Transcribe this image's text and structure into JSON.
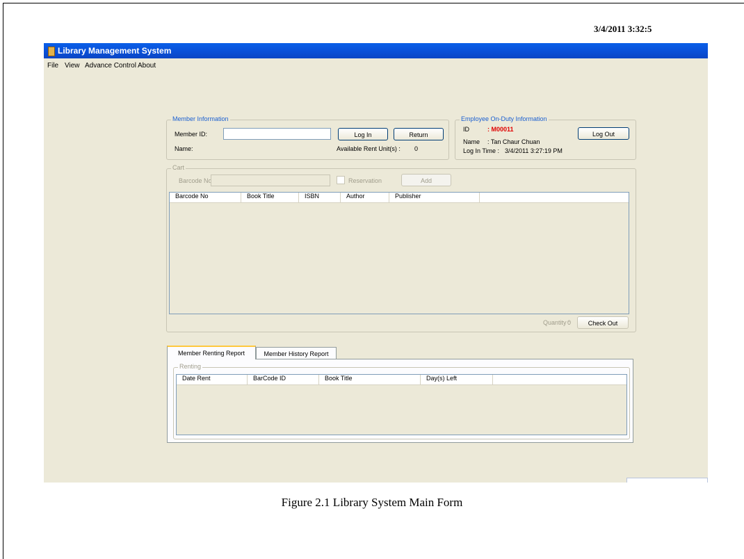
{
  "window": {
    "title": "Library Management System"
  },
  "menu": [
    "File",
    "View",
    "Advance Control",
    "About"
  ],
  "datetime": "3/4/2011 3:32:5",
  "member": {
    "legend": "Member Information",
    "id_label": "Member ID:",
    "id_value": "",
    "name_label": "Name:",
    "login_button": "Log In",
    "return_button": "Return",
    "available_label": "Available Rent Unit(s) :",
    "available_value": "0"
  },
  "employee": {
    "legend": "Employee On-Duty Information",
    "id_label": "ID",
    "id_value": ": M00011",
    "name_label": "Name",
    "name_value": ": Tan Chaur Chuan",
    "login_time_label": "Log In Time :",
    "login_time_value": "3/4/2011 3:27:19 PM",
    "logout_button": "Log Out"
  },
  "cart": {
    "legend": "Cart",
    "barcode_label": "Barcode No.",
    "barcode_value": "",
    "reservation_label": "Reservation",
    "add_button": "Add",
    "columns": [
      "Barcode No",
      "Book Title",
      "ISBN",
      "Author",
      "Publisher"
    ],
    "quantity_label": "Quantity :",
    "quantity_value": "0",
    "checkout_button": "Check Out"
  },
  "tabs": [
    "Member Renting Report",
    "Member History Report"
  ],
  "renting": {
    "legend": "Renting",
    "columns": [
      "Date Rent",
      "BarCode ID",
      "Book Title",
      "Day(s) Left"
    ]
  },
  "caption": "Figure 2.1 Library System Main Form"
}
